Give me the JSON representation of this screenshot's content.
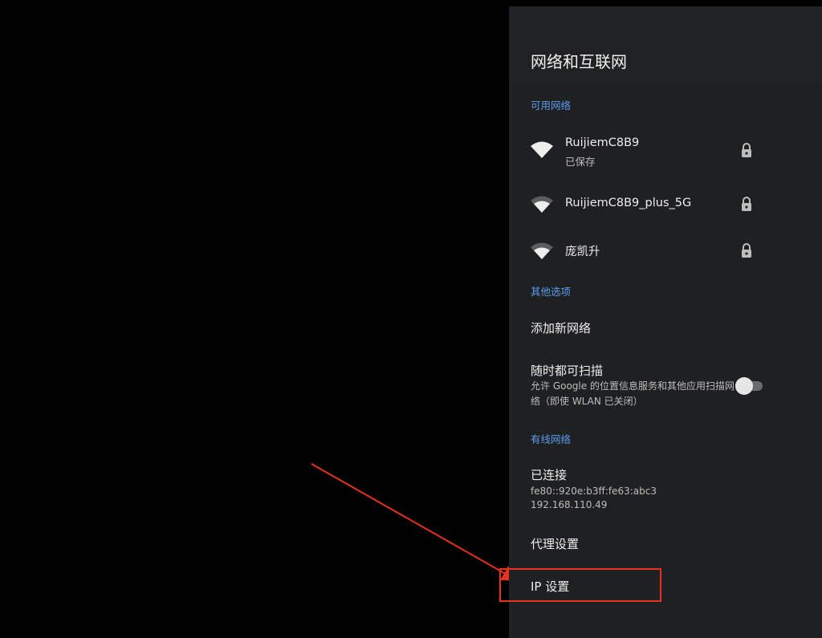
{
  "page": {
    "title": "网络和互联网"
  },
  "sections": {
    "available": "可用网络",
    "other": "其他选项",
    "wired": "有线网络"
  },
  "networks": [
    {
      "ssid": "RuijiemC8B9",
      "status": "已保存",
      "secured": true,
      "icon": "wifi-icon"
    },
    {
      "ssid": "RuijiemC8B9_plus_5G",
      "status": "",
      "secured": true,
      "icon": "wifi-icon"
    },
    {
      "ssid": "庞凯升",
      "status": "",
      "secured": true,
      "icon": "wifi-icon"
    }
  ],
  "other_options": {
    "add_network": "添加新网络",
    "scan_always": {
      "title": "随时都可扫描",
      "description": "允许 Google 的位置信息服务和其他应用扫描网络（即使 WLAN 已关闭）",
      "enabled": false
    }
  },
  "wired": {
    "status": "已连接",
    "ipv6": "fe80::920e:b3ff:fe63:abc3",
    "ipv4": "192.168.110.49",
    "proxy": "代理设置",
    "ip_settings": "IP 设置"
  },
  "colors": {
    "panel_bg": "#1f2022",
    "accent": "#5b9cf0",
    "annotation": "#e8321f"
  }
}
